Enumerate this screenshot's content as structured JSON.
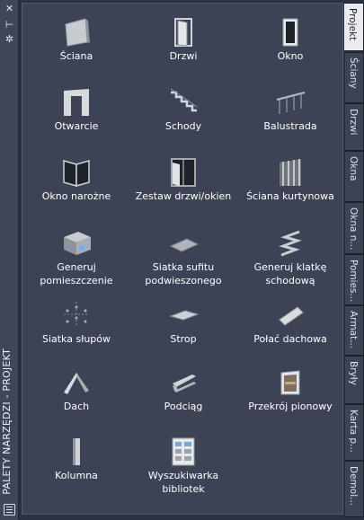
{
  "title": "PALETY NARZĘDZI - PROJEKT",
  "tools": [
    {
      "label": "Ściana",
      "icon": "wall-icon"
    },
    {
      "label": "Drzwi",
      "icon": "door-icon"
    },
    {
      "label": "Okno",
      "icon": "window-icon"
    },
    {
      "label": "Otwarcie",
      "icon": "opening-icon"
    },
    {
      "label": "Schody",
      "icon": "stair-icon"
    },
    {
      "label": "Balustrada",
      "icon": "railing-icon"
    },
    {
      "label": "Okno narożne",
      "icon": "corner-window-icon"
    },
    {
      "label": "Zestaw drzwi/okien",
      "icon": "door-window-assembly-icon"
    },
    {
      "label": "Ściana kurtynowa",
      "icon": "curtain-wall-icon"
    },
    {
      "label": "Generuj pomieszczenie",
      "icon": "space-icon"
    },
    {
      "label": "Siatka sufitu podwieszonego",
      "icon": "ceiling-grid-icon"
    },
    {
      "label": "Generuj klatkę schodową",
      "icon": "stair-tower-icon"
    },
    {
      "label": "Siatka słupów",
      "icon": "column-grid-icon"
    },
    {
      "label": "Strop",
      "icon": "slab-icon"
    },
    {
      "label": "Połać dachowa",
      "icon": "roof-slab-icon"
    },
    {
      "label": "Dach",
      "icon": "roof-icon"
    },
    {
      "label": "Podciąg",
      "icon": "beam-icon"
    },
    {
      "label": "Przekrój pionowy",
      "icon": "section-icon"
    },
    {
      "label": "Kolumna",
      "icon": "column-icon"
    },
    {
      "label": "Wyszukiwarka bibliotek",
      "icon": "library-search-icon"
    }
  ],
  "tabs": [
    {
      "label": "Projekt",
      "active": true
    },
    {
      "label": "Ściany",
      "active": false
    },
    {
      "label": "Drzwi",
      "active": false
    },
    {
      "label": "Okna",
      "active": false
    },
    {
      "label": "Okna n...",
      "active": false
    },
    {
      "label": "Pomies...",
      "active": false
    },
    {
      "label": "Armat...",
      "active": false
    },
    {
      "label": "Bryły",
      "active": false
    },
    {
      "label": "Karta p...",
      "active": false
    },
    {
      "label": "Demol...",
      "active": false
    }
  ]
}
